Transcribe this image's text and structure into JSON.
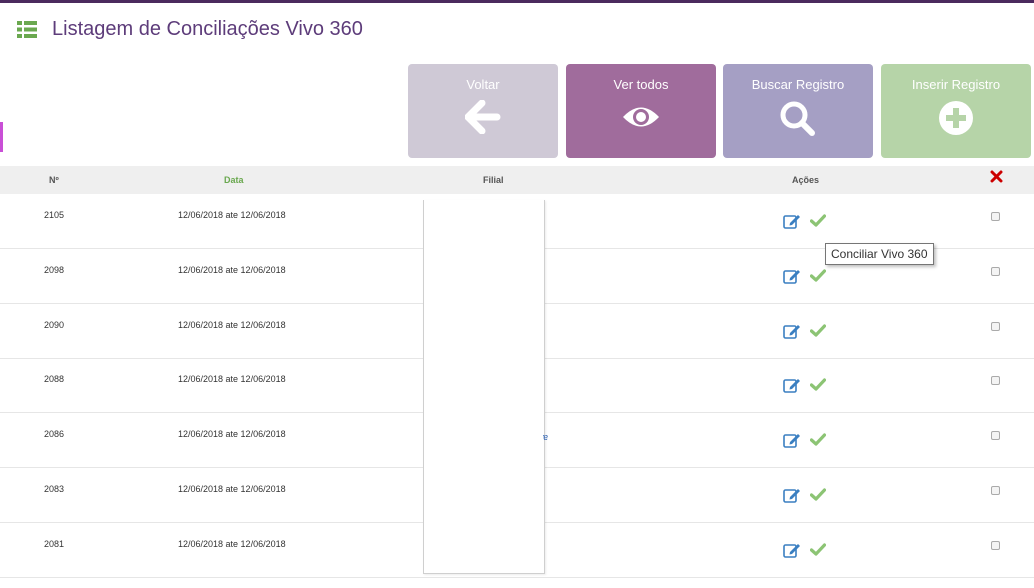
{
  "page": {
    "title": "Listagem de Conciliações Vivo 360"
  },
  "buttons": {
    "voltar": "Voltar",
    "ver_todos": "Ver todos",
    "buscar": "Buscar Registro",
    "inserir": "Inserir Registro"
  },
  "table": {
    "headers": {
      "num": "Nº",
      "data": "Data",
      "filial": "Filial",
      "acoes": "Ações"
    },
    "rows": [
      {
        "num": "2105",
        "data": "12/06/2018 ate 12/06/2018"
      },
      {
        "num": "2098",
        "data": "12/06/2018 ate 12/06/2018"
      },
      {
        "num": "2090",
        "data": "12/06/2018 ate 12/06/2018"
      },
      {
        "num": "2088",
        "data": "12/06/2018 ate 12/06/2018"
      },
      {
        "num": "2086",
        "data": "12/06/2018 ate 12/06/2018"
      },
      {
        "num": "2083",
        "data": "12/06/2018 ate 12/06/2018"
      },
      {
        "num": "2081",
        "data": "12/06/2018 ate 12/06/2018"
      }
    ]
  },
  "tooltip": {
    "text": "Conciliar Vivo 360"
  },
  "icons": {
    "list": "list-icon",
    "back": "arrow-left-icon",
    "view": "eye-icon",
    "search": "search-icon",
    "add": "plus-circle-icon",
    "delete": "close-icon",
    "edit": "edit-icon",
    "check": "check-icon"
  },
  "colors": {
    "title": "#5d3c7a",
    "voltar": "#cfc9d6",
    "ver_todos": "#a06c9c",
    "buscar": "#a59fc4",
    "inserir": "#b6d4a8",
    "delete": "#cc0000",
    "check": "#8cc474",
    "edit": "#3a7fc1"
  }
}
